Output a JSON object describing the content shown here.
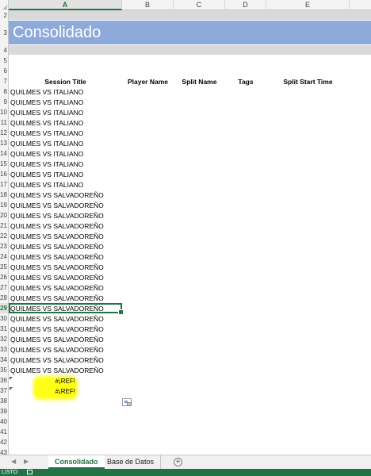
{
  "columns": [
    "A",
    "B",
    "C",
    "D",
    "E"
  ],
  "selected_column": "A",
  "title": "Consolidado",
  "headers": {
    "session_title": "Session Title",
    "player_name": "Player Name",
    "split_name": "Split Name",
    "tags": "Tags",
    "split_start_time": "Split Start Time"
  },
  "row_numbers": [
    "2",
    "3",
    "4",
    "5",
    "6",
    "7",
    "8",
    "9",
    "10",
    "11",
    "12",
    "13",
    "14",
    "15",
    "16",
    "17",
    "18",
    "19",
    "20",
    "21",
    "22",
    "23",
    "24",
    "25",
    "26",
    "27",
    "28",
    "29",
    "30",
    "31",
    "32",
    "33",
    "34",
    "35",
    "36",
    "37",
    "38",
    "39",
    "40",
    "41",
    "42",
    "43"
  ],
  "selected_row": "29",
  "rows": [
    "QUILMES VS ITALIANO",
    "QUILMES VS ITALIANO",
    "QUILMES VS ITALIANO",
    "QUILMES VS ITALIANO",
    "QUILMES VS ITALIANO",
    "QUILMES VS ITALIANO",
    "QUILMES VS ITALIANO",
    "QUILMES VS ITALIANO",
    "QUILMES VS ITALIANO",
    "QUILMES VS ITALIANO",
    "QUILMES VS SALVADOREÑO",
    "QUILMES VS SALVADOREÑO",
    "QUILMES VS SALVADOREÑO",
    "QUILMES VS SALVADOREÑO",
    "QUILMES VS SALVADOREÑO",
    "QUILMES VS SALVADOREÑO",
    "QUILMES VS SALVADOREÑO",
    "QUILMES VS SALVADOREÑO",
    "QUILMES VS SALVADOREÑO",
    "QUILMES VS SALVADOREÑO",
    "QUILMES VS SALVADOREÑO",
    "QUILMES VS SALVADOREÑO",
    "QUILMES VS SALVADOREÑO",
    "QUILMES VS SALVADOREÑO",
    "QUILMES VS SALVADOREÑO",
    "QUILMES VS SALVADOREÑO",
    "QUILMES VS SALVADOREÑO",
    "QUILMES VS SALVADOREÑO"
  ],
  "errors": [
    "#¡REF!",
    "#¡REF!"
  ],
  "sheet_tabs": [
    "Consolidado",
    "Base de Datos"
  ],
  "active_tab": "Consolidado",
  "status": "LISTO",
  "colors": {
    "accent": "#217346",
    "title_band": "#8eaadb",
    "gray_band": "#d9d9d9",
    "highlight": "#ffff00"
  }
}
